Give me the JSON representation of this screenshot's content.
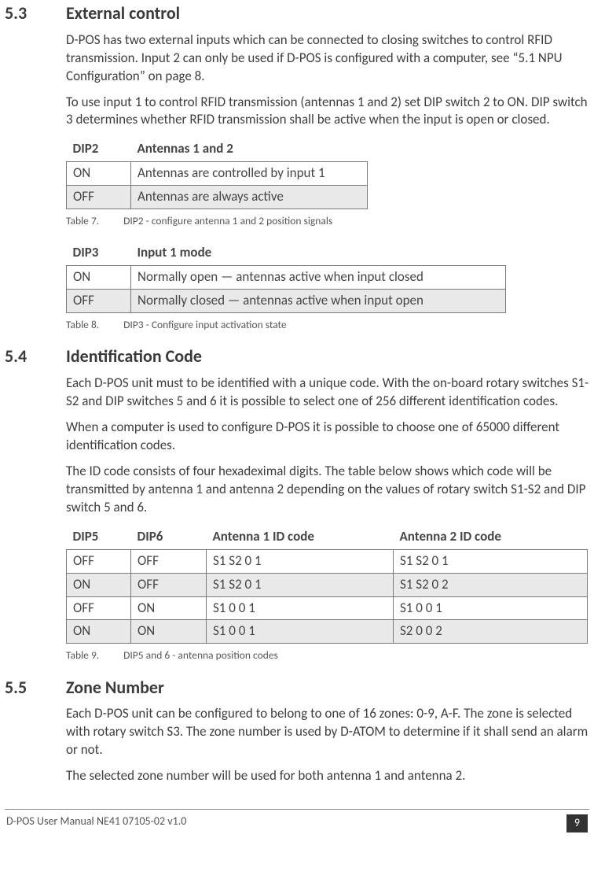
{
  "sections": {
    "s53": {
      "num": "5.3",
      "title": "External control"
    },
    "s54": {
      "num": "5.4",
      "title": "Identification Code"
    },
    "s55": {
      "num": "5.5",
      "title": "Zone Number"
    }
  },
  "p53a": "D-POS has two external inputs which can be connected to closing switches to control RFID transmission. Input 2 can only be used if D-POS is configured with a computer, see “5.1 NPU Configuration” on page 8.",
  "p53b": "To use input 1 to control RFID transmission (antennas 1 and 2) set DIP switch 2 to ON. DIP switch 3 determines whether RFID transmission shall be active when the input is open or closed.",
  "table7": {
    "head": [
      "DIP2",
      "Antennas 1 and 2"
    ],
    "rows": [
      [
        "ON",
        "Antennas are controlled by input 1"
      ],
      [
        "OFF",
        "Antennas are always active"
      ]
    ],
    "caption_num": "Table 7.",
    "caption_txt": "DIP2 - configure antenna 1 and 2 position signals"
  },
  "table8": {
    "head": [
      "DIP3",
      "Input 1 mode"
    ],
    "rows": [
      [
        "ON",
        "Normally open — antennas active when input closed"
      ],
      [
        "OFF",
        "Normally closed — antennas active when input open"
      ]
    ],
    "caption_num": "Table 8.",
    "caption_txt": "DIP3 - Configure input activation state"
  },
  "p54a": "Each D-POS unit must to be identified with a unique code. With the on-board rotary switches S1-S2 and DIP switches 5 and 6 it is possible to select one of 256 different identification codes.",
  "p54b": "When a computer is used to configure D-POS it is possible to choose one of 65000 different identification codes.",
  "p54c": "The ID code consists of four hexadeximal digits. The table below shows which code will be transmitted by antenna 1 and antenna 2 depending on the values of rotary switch S1-S2 and DIP switch 5 and 6.",
  "table9": {
    "head": [
      "DIP5",
      "DIP6",
      "Antenna 1 ID code",
      "Antenna 2 ID code"
    ],
    "rows": [
      [
        "OFF",
        "OFF",
        "S1 S2 0 1",
        "S1 S2 0 1"
      ],
      [
        "ON",
        "OFF",
        "S1 S2 0 1",
        "S1 S2 0 2"
      ],
      [
        "OFF",
        "ON",
        "S1 0 0 1",
        "S1 0 0 1"
      ],
      [
        "ON",
        "ON",
        "S1 0 0 1",
        "S2 0 0 2"
      ]
    ],
    "caption_num": "Table 9.",
    "caption_txt": "DIP5 and 6 - antenna position codes"
  },
  "p55a": "Each D-POS unit can be configured to belong to one of 16 zones: 0-9, A-F. The zone is selected with rotary switch S3. The zone number is used by D-ATOM to determine if it shall send an alarm or not.",
  "p55b": "The selected zone number will be used for both antenna 1 and antenna 2.",
  "footer": {
    "left": "D-POS User Manual NE41 07105-02 v1.0",
    "page": "9"
  }
}
